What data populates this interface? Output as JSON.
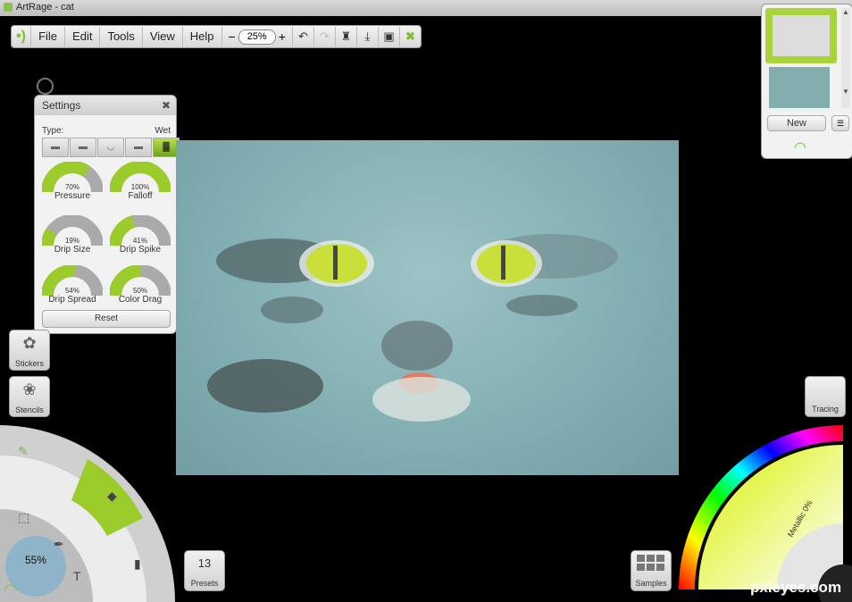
{
  "window": {
    "title": "ArtRage - cat"
  },
  "menu": {
    "items": [
      "File",
      "Edit",
      "Tools",
      "View",
      "Help"
    ],
    "zoom_minus": "−",
    "zoom_value": "25%",
    "zoom_plus": "+"
  },
  "settings": {
    "title": "Settings",
    "type_label": "Type:",
    "type_value": "Wet",
    "gauges": [
      {
        "value": "70%",
        "level": 0.7,
        "label": "Pressure"
      },
      {
        "value": "100%",
        "level": 1.0,
        "label": "Falloff"
      },
      {
        "value": "19%",
        "level": 0.19,
        "label": "Drip Size"
      },
      {
        "value": "41%",
        "level": 0.41,
        "label": "Drip Spike"
      },
      {
        "value": "54%",
        "level": 0.54,
        "label": "Drip Spread"
      },
      {
        "value": "50%",
        "level": 0.5,
        "label": "Color Drag"
      }
    ],
    "reset_label": "Reset"
  },
  "layers": {
    "new_label": "New"
  },
  "side": {
    "stickers": "Stickers",
    "stencils": "Stencils"
  },
  "tool_zoom": "55%",
  "presets": {
    "count": "13",
    "label": "Presets"
  },
  "samples": {
    "label": "Samples"
  },
  "tracing": {
    "label": "Tracing"
  },
  "color": {
    "metallic": "Metallic 0%"
  },
  "watermark": "pxleyes.com",
  "colors": {
    "accent": "#9ccc2c",
    "panel": "#f2f2f2"
  }
}
